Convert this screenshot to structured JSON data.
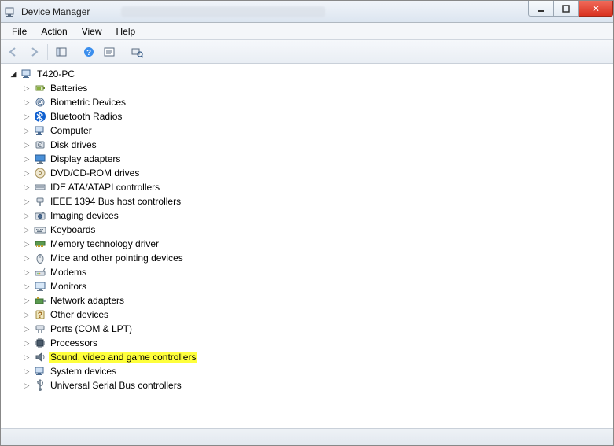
{
  "window": {
    "title": "Device Manager"
  },
  "menu": {
    "file": "File",
    "action": "Action",
    "view": "View",
    "help": "Help"
  },
  "tree": {
    "root": {
      "label": "T420-PC",
      "expanded": true,
      "icon": "computer"
    },
    "children": [
      {
        "label": "Batteries",
        "icon": "battery"
      },
      {
        "label": "Biometric Devices",
        "icon": "biometric"
      },
      {
        "label": "Bluetooth Radios",
        "icon": "bluetooth"
      },
      {
        "label": "Computer",
        "icon": "computer"
      },
      {
        "label": "Disk drives",
        "icon": "disk"
      },
      {
        "label": "Display adapters",
        "icon": "display"
      },
      {
        "label": "DVD/CD-ROM drives",
        "icon": "dvd"
      },
      {
        "label": "IDE ATA/ATAPI controllers",
        "icon": "ide"
      },
      {
        "label": "IEEE 1394 Bus host controllers",
        "icon": "ieee1394"
      },
      {
        "label": "Imaging devices",
        "icon": "imaging"
      },
      {
        "label": "Keyboards",
        "icon": "keyboard"
      },
      {
        "label": "Memory technology driver",
        "icon": "memory"
      },
      {
        "label": "Mice and other pointing devices",
        "icon": "mouse"
      },
      {
        "label": "Modems",
        "icon": "modem"
      },
      {
        "label": "Monitors",
        "icon": "monitor"
      },
      {
        "label": "Network adapters",
        "icon": "network"
      },
      {
        "label": "Other devices",
        "icon": "other"
      },
      {
        "label": "Ports (COM & LPT)",
        "icon": "port"
      },
      {
        "label": "Processors",
        "icon": "processor"
      },
      {
        "label": "Sound, video and game controllers",
        "icon": "sound",
        "highlighted": true
      },
      {
        "label": "System devices",
        "icon": "system"
      },
      {
        "label": "Universal Serial Bus controllers",
        "icon": "usb"
      }
    ]
  }
}
